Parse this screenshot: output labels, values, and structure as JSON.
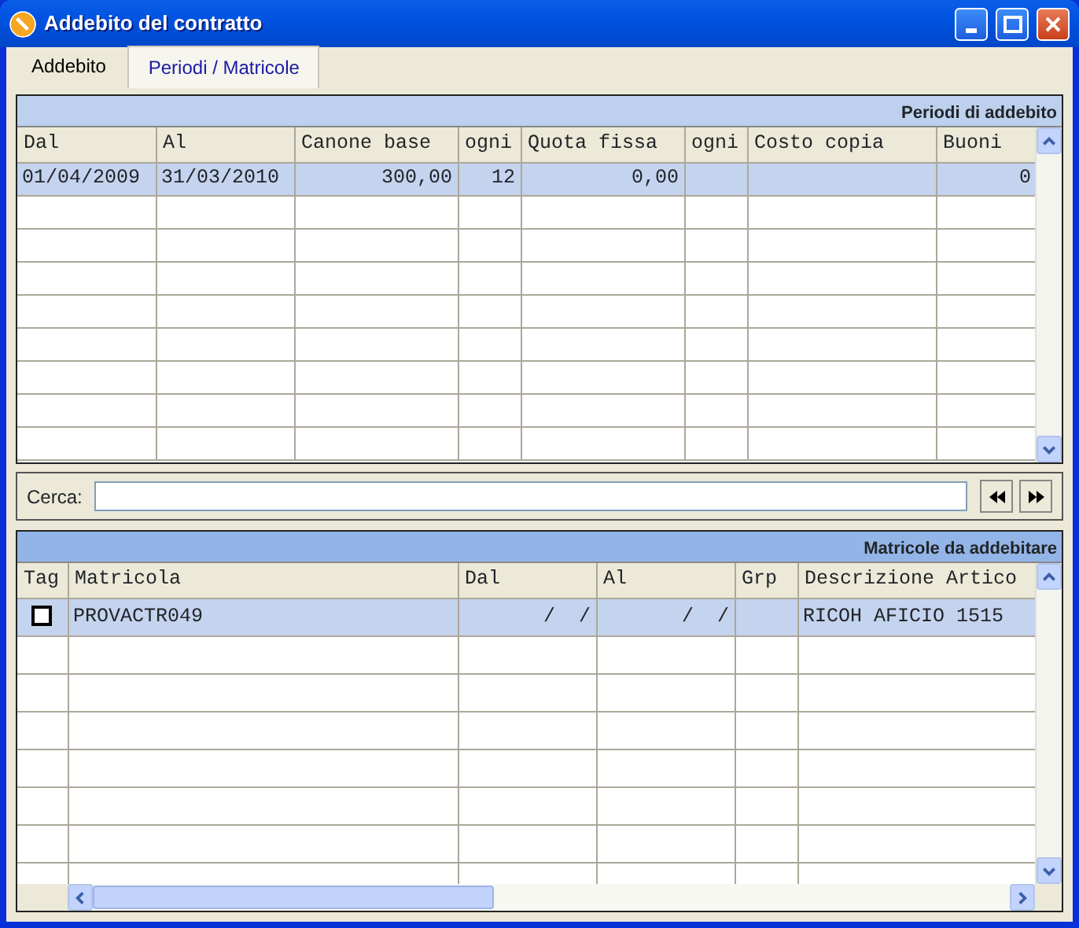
{
  "window": {
    "title": "Addebito del contratto"
  },
  "tabs": [
    {
      "label": "Addebito",
      "selected": false
    },
    {
      "label": "Periodi / Matricole",
      "selected": true
    }
  ],
  "periods_grid": {
    "title": "Periodi di addebito",
    "focused": false,
    "columns": [
      {
        "label": "Dal"
      },
      {
        "label": "Al"
      },
      {
        "label": "Canone base"
      },
      {
        "label": "ogni"
      },
      {
        "label": "Quota fissa"
      },
      {
        "label": "ogni"
      },
      {
        "label": "Costo copia"
      },
      {
        "label": "Buoni"
      }
    ],
    "rows": [
      {
        "selected": true,
        "cells": [
          "01/04/2009",
          "31/03/2010",
          "300,00",
          "12",
          "0,00",
          "",
          "",
          "0"
        ]
      }
    ]
  },
  "search": {
    "label": "Cerca:"
  },
  "serials_grid": {
    "title": "Matricole da addebitare",
    "focused": true,
    "columns": [
      {
        "label": "Tag"
      },
      {
        "label": "Matricola"
      },
      {
        "label": "Dal"
      },
      {
        "label": "Al"
      },
      {
        "label": "Grp"
      },
      {
        "label": "Descrizione Artico"
      }
    ],
    "rows": [
      {
        "selected": true,
        "tag_checked": false,
        "cells": [
          "",
          "PROVACTR049",
          "/  /",
          "/  /",
          "",
          "RICOH AFICIO 1515"
        ]
      }
    ]
  }
}
